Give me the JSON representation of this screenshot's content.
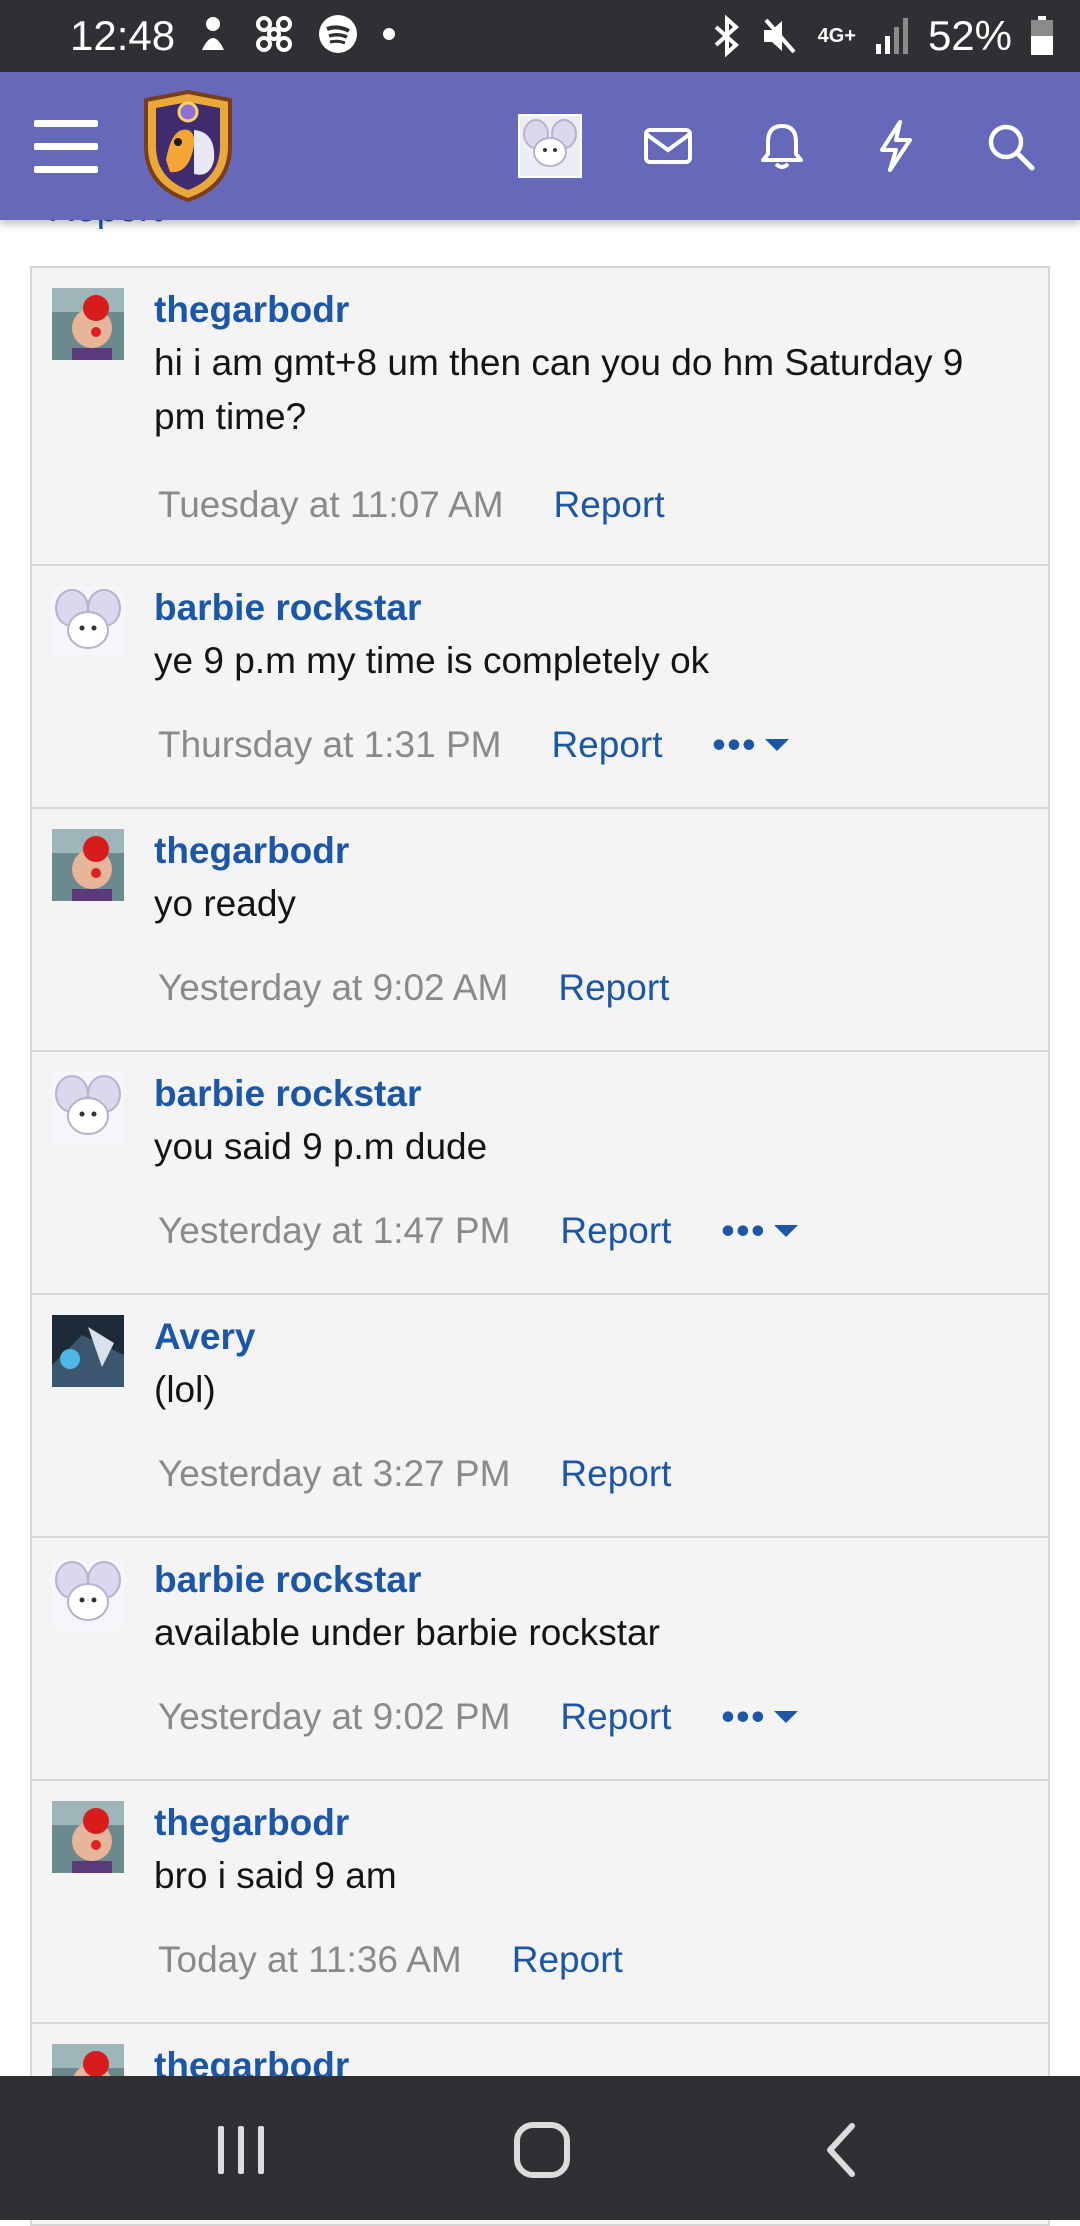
{
  "status_bar": {
    "time": "12:48",
    "battery_percent": "52%",
    "network": "4G+",
    "left_icons": [
      "silent-mode-icon",
      "pinwheel-icon",
      "spotify-icon",
      "dot-icon"
    ],
    "right_icons": [
      "bluetooth-icon",
      "mute-vibrate-icon",
      "signal-icon",
      "battery-icon"
    ]
  },
  "header": {
    "icons": [
      "menu-icon",
      "site-logo",
      "user-avatar",
      "inbox-icon",
      "alerts-bell-icon",
      "whats-new-bolt-icon",
      "search-icon"
    ],
    "colors": {
      "bar": "#6668b9"
    }
  },
  "prev_report_label": "Report",
  "colors": {
    "link": "#1c56a6",
    "meta": "#8a8a8a",
    "card_bg": "#f4f4f4"
  },
  "messages": [
    {
      "author": "thegarbodr",
      "text": "hi i am gmt+8 um then can you do hm Saturday 9 pm time?",
      "time": "Tuesday at 11:07 AM",
      "report": "Report",
      "more": ""
    },
    {
      "author": "barbie rockstar",
      "text": "ye 9 p.m my time is completely ok",
      "time": "Thursday at 1:31 PM",
      "report": "Report",
      "more": "•••"
    },
    {
      "author": "thegarbodr",
      "text": "yo ready",
      "time": "Yesterday at 9:02 AM",
      "report": "Report",
      "more": ""
    },
    {
      "author": "barbie rockstar",
      "text": "you said 9 p.m dude",
      "time": "Yesterday at 1:47 PM",
      "report": "Report",
      "more": "•••"
    },
    {
      "author": "Avery",
      "text": "(lol)",
      "time": "Yesterday at 3:27 PM",
      "report": "Report",
      "more": ""
    },
    {
      "author": "barbie rockstar",
      "text": "available under barbie rockstar",
      "time": "Yesterday at 9:02 PM",
      "report": "Report",
      "more": "•••"
    },
    {
      "author": "thegarbodr",
      "text": "bro i said 9 am",
      "time": "Today at 11:36 AM",
      "report": "Report",
      "more": ""
    },
    {
      "author": "thegarbodr",
      "text": "",
      "time": "",
      "report": "",
      "more": ""
    }
  ],
  "nav_bar": {
    "icons": [
      "recent-apps-icon",
      "home-icon",
      "back-icon"
    ]
  }
}
